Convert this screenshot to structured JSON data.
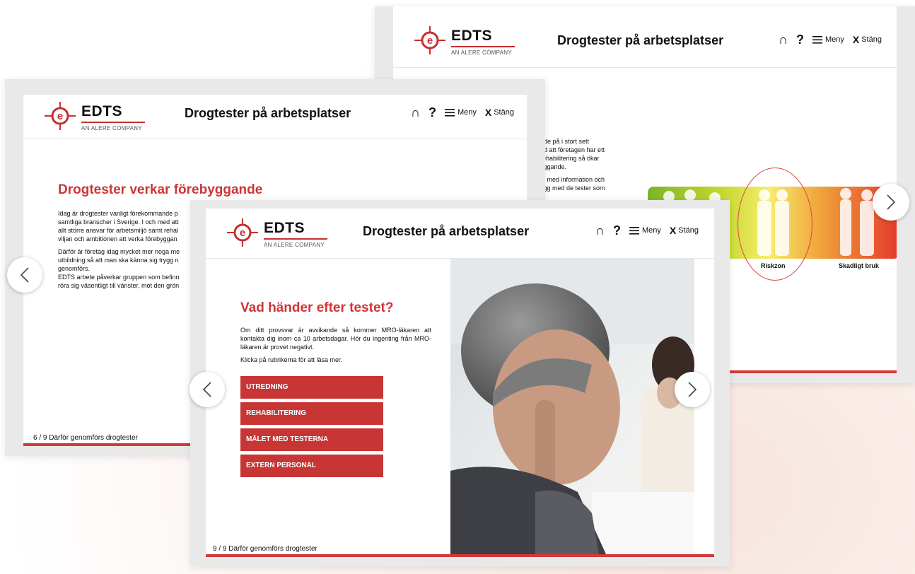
{
  "app": {
    "brand": "EDTS",
    "brand_sub": "AN ALERE COMPANY",
    "title": "Drogtester på arbetsplatser",
    "nav_menu": "Meny",
    "nav_close_x": "X",
    "nav_close": "Stäng"
  },
  "colors": {
    "accent": "#c73535",
    "frame": "#e9e9e9"
  },
  "icons": {
    "home": "home-icon",
    "help": "help-icon",
    "menu": "hamburger-icon",
    "close": "close-icon",
    "prev": "chevron-left-icon",
    "next": "chevron-right-icon"
  },
  "slide_back": {
    "body_lines": [
      "ude på i stort sett",
      "ed att företagen har ett",
      "rehabilitering så ökar",
      "yggande.",
      "ja med information och",
      "ygg med de tester som"
    ],
    "gauge_labels": {
      "risk": "Riskzon",
      "harm": "Skadligt bruk"
    }
  },
  "slide_mid": {
    "heading": "Drogtester verkar förebyggande",
    "paragraphs": [
      "Idag är drogtester vanligt förekommande p",
      "samtliga branscher i Sverige. I och med att",
      "allt större ansvar för arbetsmiljö samt rehal",
      "viljan och ambitionen att verka förebyggan"
    ],
    "paragraphs2": [
      "Därför är företag idag mycket mer noga me",
      "utbildning så att man ska känna sig trygg n",
      "genomförs.",
      "EDTS arbete påverkar gruppen som befinn",
      "röra sig väsentligt till vänster, mot den grön"
    ],
    "footer": "6 / 9   Därför genomförs drogtester"
  },
  "slide_front": {
    "heading": "Vad händer efter testet?",
    "intro": "Om ditt provsvar är avvikande så kommer MRO-läkaren att kontakta dig inom ca 10 arbetsdagar. Hör du ingenting från MRO-läkaren är provet negativt.",
    "hint": "Klicka på rubrikerna för att läsa mer.",
    "buttons": [
      "UTREDNING",
      "REHABILITERING",
      "MÅLET MED TESTERNA",
      "EXTERN PERSONAL"
    ],
    "footer": "9 / 9   Därför genomförs drogtester"
  }
}
